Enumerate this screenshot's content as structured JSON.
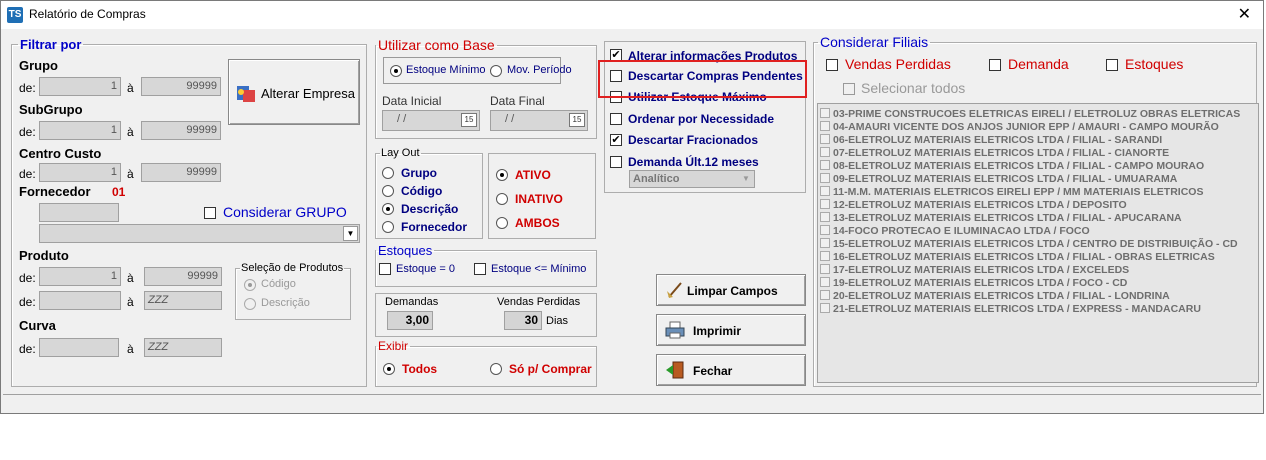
{
  "window": {
    "title": "Relatório de Compras",
    "app_icon": "TS"
  },
  "filtrar": {
    "legend": "Filtrar por",
    "grupo_label": "Grupo",
    "subgrupo_label": "SubGrupo",
    "centro_custo_label": "Centro Custo",
    "fornecedor_label": "Fornecedor",
    "fornecedor_code": "01",
    "produto_label": "Produto",
    "curva_label": "Curva",
    "de": "de:",
    "a": "à",
    "grupo_from": "1",
    "grupo_to": "99999",
    "subgrupo_from": "1",
    "subgrupo_to": "99999",
    "centro_from": "1",
    "centro_to": "99999",
    "produto_from": "1",
    "produto_to": "99999",
    "curva_to": "ZZZ",
    "produto_zzz": "ZZZ",
    "considerar_grupo": "Considerar GRUPO",
    "alterar_empresa": "Alterar Empresa",
    "selecao_legend": "Seleção de Produtos",
    "selecao_codigo": "Código",
    "selecao_descricao": "Descrição"
  },
  "base": {
    "legend": "Utilizar como Base",
    "estoque_minimo": "Estoque Mínimo",
    "mov_periodo": "Mov. Período",
    "data_inicial": "Data Inicial",
    "data_final": "Data Final",
    "date_placeholder": "/ /",
    "cal_icon_text": "15"
  },
  "layout": {
    "legend": "Lay Out",
    "grupo": "Grupo",
    "codigo": "Código",
    "descricao": "Descrição",
    "fornecedor": "Fornecedor",
    "ativo": "ATIVO",
    "inativo": "INATIVO",
    "ambos": "AMBOS"
  },
  "estoques": {
    "legend": "Estoques",
    "igual_zero": "Estoque = 0",
    "menor_minimo": "Estoque <= Mínimo"
  },
  "demandas": {
    "label": "Demandas",
    "value": "3,00",
    "vendas_label": "Vendas Perdidas",
    "vendas_value": "30",
    "dias": "Dias"
  },
  "exibir": {
    "legend": "Exibir",
    "todos": "Todos",
    "so_comprar": "Só p/ Comprar"
  },
  "options": {
    "alterar_info": "Alterar informações Produtos",
    "descartar_compras": "Descartar Compras Pendentes",
    "utilizar_estoque": "Utilizar Estoque Máximo",
    "ordenar": "Ordenar por Necessidade",
    "descartar_fracionados": "Descartar Fracionados",
    "demanda_ult": "Demanda Últ.12 meses",
    "analitico": "Analítico"
  },
  "buttons": {
    "limpar": "Limpar Campos",
    "imprimir": "Imprimir",
    "fechar": "Fechar"
  },
  "filiais": {
    "legend": "Considerar Filiais",
    "vendas_perdidas": "Vendas Perdidas",
    "demanda": "Demanda",
    "estoques": "Estoques",
    "selecionar_todos": "Selecionar todos",
    "items": [
      "03-PRIME CONSTRUCOES ELETRICAS EIRELI / ELETROLUZ OBRAS ELETRICAS",
      "04-AMAURI VICENTE DOS ANJOS JUNIOR EPP / AMAURI - CAMPO MOURÃO",
      "06-ELETROLUZ MATERIAIS ELETRICOS LTDA / FILIAL - SARANDI",
      "07-ELETROLUZ MATERIAIS ELETRICOS LTDA / FILIAL - CIANORTE",
      "08-ELETROLUZ MATERIAIS ELETRICOS LTDA / FILIAL - CAMPO MOURAO",
      "09-ELETROLUZ MATERIAIS ELETRICOS LTDA / FILIAL - UMUARAMA",
      "11-M.M. MATERIAIS ELETRICOS EIRELI EPP / MM MATERIAIS ELETRICOS",
      "12-ELETROLUZ MATERIAIS ELETRICOS LTDA / DEPOSITO",
      "13-ELETROLUZ MATERIAIS ELETRICOS LTDA / FILIAL - APUCARANA",
      "14-FOCO PROTECAO E ILUMINACAO LTDA / FOCO",
      "15-ELETROLUZ MATERIAIS ELETRICOS LTDA  / CENTRO DE DISTRIBUIÇÃO - CD",
      "16-ELETROLUZ MATERIAIS ELETRICOS LTDA / FILIAL - OBRAS ELETRICAS",
      "17-ELETROLUZ MATERIAIS ELETRICOS LTDA / EXCELEDS",
      "19-ELETROLUZ MATERIAIS ELETRICOS LTDA / FOCO - CD",
      "20-ELETROLUZ MATERIAIS ELETRICOS LTDA  / FILIAL - LONDRINA",
      "21-ELETROLUZ MATERIAIS ELETRICOS LTDA / EXPRESS - MANDACARU"
    ]
  },
  "colors": {
    "accent_blue": "#0000c8",
    "accent_red": "#d00000",
    "highlight": "#e02020"
  }
}
